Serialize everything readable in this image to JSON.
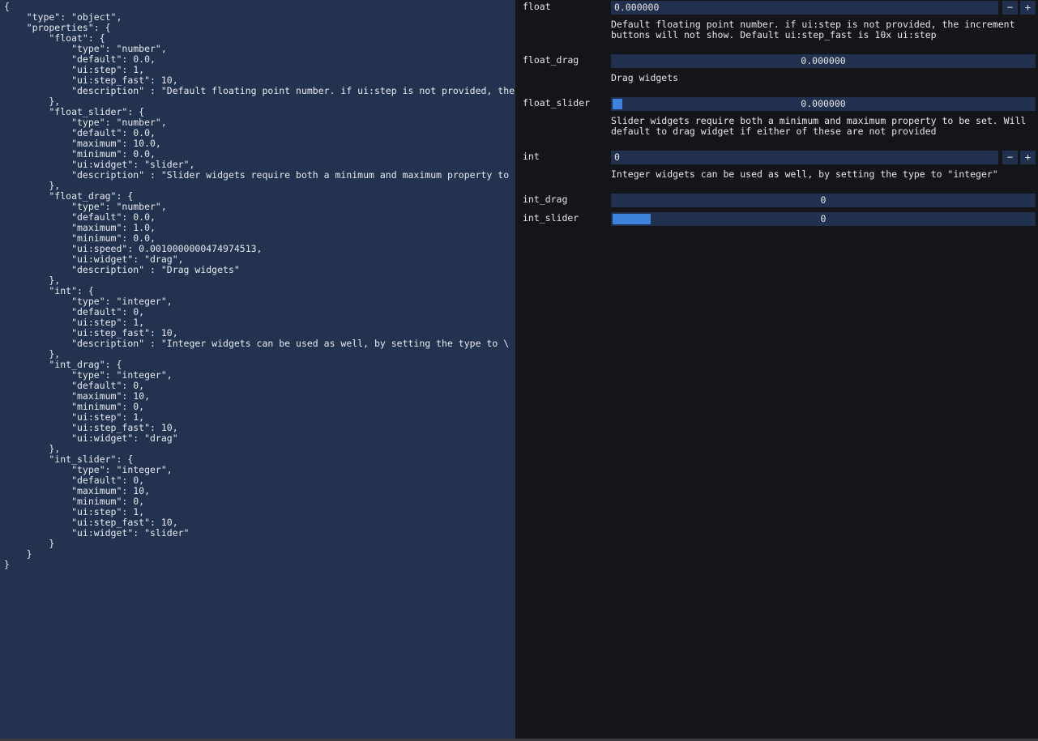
{
  "editor": {
    "lines": [
      "{",
      "    \"type\": \"object\",",
      "    \"properties\": {",
      "        \"float\": {",
      "            \"type\": \"number\",",
      "            \"default\": 0.0,",
      "            \"ui:step\": 1,",
      "            \"ui:step_fast\": 10,",
      "            \"description\" : \"Default floating point number. if ui:step is not provided, the",
      "        },",
      "        \"float_slider\": {",
      "            \"type\": \"number\",",
      "            \"default\": 0.0,",
      "            \"maximum\": 10.0,",
      "            \"minimum\": 0.0,",
      "            \"ui:widget\": \"slider\",",
      "            \"description\" : \"Slider widgets require both a minimum and maximum property to",
      "        },",
      "        \"float_drag\": {",
      "            \"type\": \"number\",",
      "            \"default\": 0.0,",
      "            \"maximum\": 1.0,",
      "            \"minimum\": 0.0,",
      "            \"ui:speed\": 0.0010000000474974513,",
      "            \"ui:widget\": \"drag\",",
      "            \"description\" : \"Drag widgets\"",
      "        },",
      "        \"int\": {",
      "            \"type\": \"integer\",",
      "            \"default\": 0,",
      "            \"ui:step\": 1,",
      "            \"ui:step_fast\": 10,",
      "            \"description\" : \"Integer widgets can be used as well, by setting the type to \\",
      "        },",
      "        \"int_drag\": {",
      "            \"type\": \"integer\",",
      "            \"default\": 0,",
      "            \"maximum\": 10,",
      "            \"minimum\": 0,",
      "            \"ui:step\": 1,",
      "            \"ui:step_fast\": 10,",
      "            \"ui:widget\": \"drag\"",
      "        },",
      "        \"int_slider\": {",
      "            \"type\": \"integer\",",
      "            \"default\": 0,",
      "            \"maximum\": 10,",
      "            \"minimum\": 0,",
      "            \"ui:step\": 1,",
      "            \"ui:step_fast\": 10,",
      "            \"ui:widget\": \"slider\"",
      "        }",
      "    }",
      "}"
    ]
  },
  "panel": {
    "float": {
      "label": "float",
      "value": "0.000000",
      "minus": "−",
      "plus": "+",
      "desc1": "Default floating point number. if ui:step is not provided, the increment",
      "desc2": "buttons will not show. Default ui:step_fast is 10x ui:step"
    },
    "float_drag": {
      "label": "float_drag",
      "value": "0.000000",
      "desc": "Drag widgets"
    },
    "float_slider": {
      "label": "float_slider",
      "value": "0.000000",
      "fill": 0.0,
      "desc1": "Slider widgets require both a minimum and maximum property to be set. Will",
      "desc2": "default to drag widget if either of these are not provided"
    },
    "int": {
      "label": "int",
      "value": "0",
      "minus": "−",
      "plus": "+",
      "desc": "Integer widgets can be used as well, by setting the type to \"integer\""
    },
    "int_drag": {
      "label": "int_drag",
      "value": "0"
    },
    "int_slider": {
      "label": "int_slider",
      "value": "0",
      "fill": 0.0
    }
  },
  "colors": {
    "editor_bg": "#22324f",
    "panel_bg": "#141518",
    "field_bg": "#21304f",
    "slider_grab": "#3d83de"
  }
}
